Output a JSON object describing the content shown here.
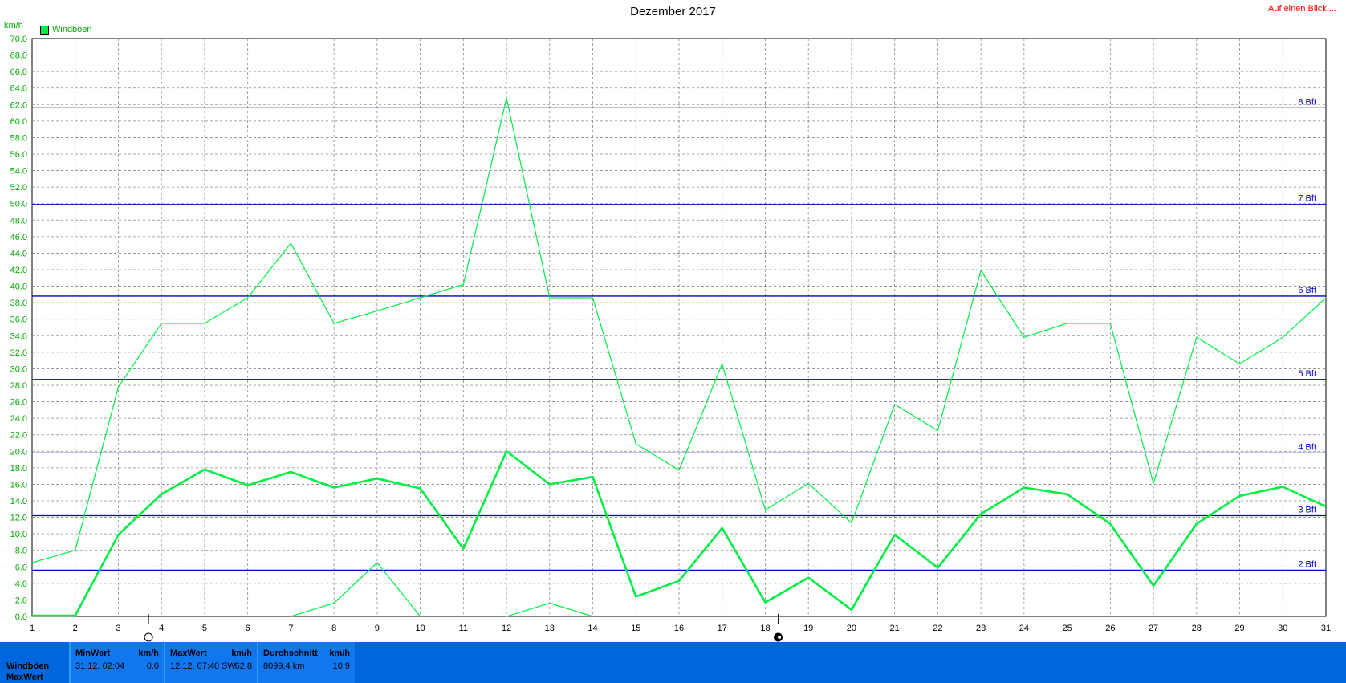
{
  "title": "Dezember 2017",
  "top_link": "Auf einen Blick ...",
  "y_unit": "km/h",
  "legend_label": "Windböen",
  "chart_data": {
    "type": "line",
    "title": "Dezember 2017",
    "ylabel": "km/h",
    "ylim": [
      0,
      70
    ],
    "xlim": [
      1,
      31
    ],
    "y_ticks": [
      "0.0",
      "2.0",
      "4.0",
      "6.0",
      "8.0",
      "10.0",
      "12.0",
      "14.0",
      "16.0",
      "18.0",
      "20.0",
      "22.0",
      "24.0",
      "26.0",
      "28.0",
      "30.0",
      "32.0",
      "34.0",
      "36.0",
      "38.0",
      "40.0",
      "42.0",
      "44.0",
      "46.0",
      "48.0",
      "50.0",
      "52.0",
      "54.0",
      "56.0",
      "58.0",
      "60.0",
      "62.0",
      "64.0",
      "66.0",
      "68.0",
      "70.0"
    ],
    "x_ticks": [
      "1",
      "2",
      "3",
      "4",
      "5",
      "6",
      "7",
      "8",
      "9",
      "10",
      "11",
      "12",
      "13",
      "14",
      "15",
      "16",
      "17",
      "18",
      "19",
      "20",
      "21",
      "22",
      "23",
      "24",
      "25",
      "26",
      "27",
      "28",
      "29",
      "30",
      "31"
    ],
    "grid": true,
    "legend": "top-left",
    "series": [
      {
        "name": "Windböen",
        "color": "#00ee44",
        "x": [
          1,
          2,
          3,
          4,
          5,
          6,
          7,
          8,
          9,
          10,
          11,
          12,
          13,
          14,
          15,
          16,
          17,
          18,
          19,
          20,
          21,
          22,
          23,
          24,
          25,
          26,
          27,
          28,
          29,
          30,
          31
        ],
        "values": [
          6.5,
          8.0,
          27.8,
          35.5,
          35.5,
          38.6,
          45.2,
          35.5,
          37.0,
          38.6,
          40.2,
          62.8,
          38.6,
          38.6,
          20.9,
          17.7,
          30.6,
          12.9,
          16.1,
          11.3,
          25.7,
          22.5,
          41.9,
          33.8,
          35.5,
          35.5,
          16.1,
          33.8,
          30.6,
          33.8,
          38.6
        ]
      },
      {
        "color": "#00ee44",
        "x": [
          1,
          2,
          3,
          4,
          5,
          6,
          7,
          8,
          9,
          10,
          11,
          12,
          13,
          14,
          15,
          16,
          17,
          18,
          19,
          20,
          21,
          22,
          23,
          24,
          25,
          26,
          27,
          28,
          29,
          30,
          31
        ],
        "values": [
          0.1,
          0.1,
          9.9,
          14.8,
          17.8,
          15.9,
          17.5,
          15.6,
          16.7,
          15.5,
          8.2,
          20.0,
          16.0,
          16.9,
          2.4,
          4.3,
          10.7,
          1.7,
          4.7,
          0.8,
          9.9,
          5.9,
          12.4,
          15.6,
          14.8,
          11.2,
          3.7,
          11.2,
          14.6,
          15.7,
          13.3
        ]
      },
      {
        "color": "#00ee44",
        "segments": [
          {
            "x": [
              7,
              8,
              9,
              10
            ],
            "values": [
              0.0,
              1.6,
              6.5,
              0.0
            ]
          },
          {
            "x": [
              12,
              13,
              14
            ],
            "values": [
              0.0,
              1.6,
              0.0
            ]
          }
        ]
      }
    ],
    "reference_lines": [
      {
        "label": "2 Bft",
        "value": 5.6
      },
      {
        "label": "3 Bft",
        "value": 12.2
      },
      {
        "label": "4 Bft",
        "value": 19.8
      },
      {
        "label": "5 Bft",
        "value": 28.7
      },
      {
        "label": "6 Bft",
        "value": 38.8
      },
      {
        "label": "7 Bft",
        "value": 49.9
      },
      {
        "label": "8 Bft",
        "value": 61.6
      }
    ],
    "reference_color": "#0000cc",
    "moon_markers": [
      {
        "type": "full-moon",
        "day": 3.7
      },
      {
        "type": "new-moon",
        "day": 18.3
      }
    ]
  },
  "stats_panel": {
    "row_labels": [
      "Windböen",
      "MaxWert"
    ],
    "min": {
      "header": "MinWert",
      "unit": "km/h",
      "datetime": "31.12.  02:04",
      "value": "0.0"
    },
    "max": {
      "header": "MaxWert",
      "unit": "km/h",
      "datetime": "12.12.  07:40",
      "direction": "SW",
      "value": "62.8"
    },
    "avg": {
      "header": "Durchschnitt",
      "unit": "km/h",
      "distance": "8099.4 km",
      "value": "10.9"
    }
  }
}
